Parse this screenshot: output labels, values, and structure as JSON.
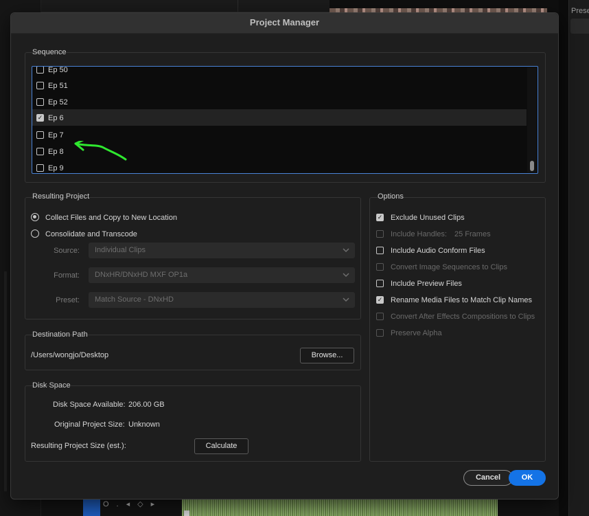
{
  "background": {
    "right_panel_label": "Prese"
  },
  "dialog": {
    "title": "Project Manager",
    "sequence": {
      "title": "Sequence",
      "items": [
        {
          "label": "Ep 50",
          "checked": false
        },
        {
          "label": "Ep 51",
          "checked": false
        },
        {
          "label": "Ep 52",
          "checked": false
        },
        {
          "label": "Ep 6",
          "checked": true
        },
        {
          "label": "Ep 7",
          "checked": false
        },
        {
          "label": "Ep 8",
          "checked": false
        },
        {
          "label": "Ep 9",
          "checked": false
        }
      ],
      "annotation_arrow_color": "#2fe82f"
    },
    "resulting_project": {
      "title": "Resulting Project",
      "options": [
        {
          "label": "Collect Files and Copy to New Location",
          "selected": true
        },
        {
          "label": "Consolidate and Transcode",
          "selected": false
        }
      ],
      "source": {
        "label": "Source:",
        "value": "Individual Clips"
      },
      "format": {
        "label": "Format:",
        "value": "DNxHR/DNxHD MXF OP1a"
      },
      "preset": {
        "label": "Preset:",
        "value": "Match Source - DNxHD"
      }
    },
    "options": {
      "title": "Options",
      "exclude_unused": {
        "label": "Exclude Unused Clips",
        "checked": true
      },
      "include_handles": {
        "label": "Include Handles:",
        "value": "25 Frames",
        "checked": false,
        "enabled": false
      },
      "include_audio_conform": {
        "label": "Include Audio Conform Files",
        "checked": false
      },
      "convert_image_sequences": {
        "label": "Convert Image Sequences to Clips",
        "checked": false,
        "enabled": false
      },
      "include_preview": {
        "label": "Include Preview Files",
        "checked": false
      },
      "rename_media": {
        "label": "Rename Media Files to Match Clip Names",
        "checked": true
      },
      "convert_ae": {
        "label": "Convert After Effects Compositions to Clips",
        "checked": false,
        "enabled": false
      },
      "preserve_alpha": {
        "label": "Preserve Alpha",
        "checked": false,
        "enabled": false
      }
    },
    "destination": {
      "title": "Destination Path",
      "path": "/Users/wongjo/Desktop",
      "browse_label": "Browse..."
    },
    "disk_space": {
      "title": "Disk Space",
      "available_label": "Disk Space Available:",
      "available_value": "206.00 GB",
      "original_label": "Original Project Size:",
      "original_value": "Unknown",
      "resulting_label": "Resulting Project Size (est.):",
      "calculate_label": "Calculate"
    },
    "cancel_label": "Cancel",
    "ok_label": "OK",
    "ok_color": "#1473e6"
  }
}
